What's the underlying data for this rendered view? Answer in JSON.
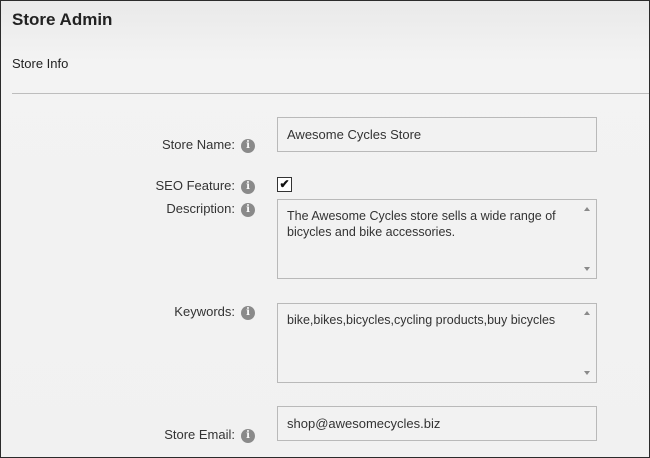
{
  "app": {
    "title": "Store Admin"
  },
  "section": {
    "title": "Store Info"
  },
  "fields": {
    "store_name": {
      "label": "Store Name:",
      "value": "Awesome Cycles Store"
    },
    "seo_feature": {
      "label": "SEO Feature:",
      "checked": true,
      "check_glyph": "✔"
    },
    "description": {
      "label": "Description:",
      "value": "The Awesome Cycles store sells a wide range of bicycles and bike accessories."
    },
    "keywords": {
      "label": "Keywords:",
      "value": "bike,bikes,bicycles,cycling products,buy bicycles"
    },
    "store_email": {
      "label": "Store Email:",
      "value": "shop@awesomecycles.biz"
    }
  },
  "icons": {
    "info": "i"
  },
  "colors": {
    "info_icon": "#8a8a8a",
    "field_bg": "#f2f2f2",
    "field_border": "#b9b9b9"
  }
}
